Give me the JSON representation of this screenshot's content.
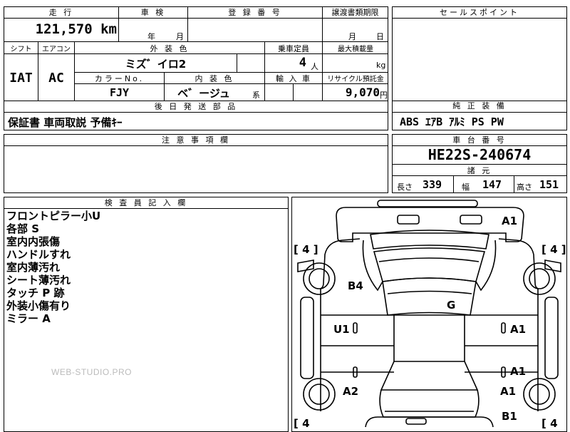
{
  "top": {
    "mileage_label": "走 行",
    "mileage_value": "121,570",
    "mileage_unit": "km",
    "inspection_label": "車 検",
    "inspection_year": "年",
    "inspection_month": "月",
    "registration_label": "登 録 番 号",
    "transfer_label": "譲渡書類期限",
    "transfer_month": "月",
    "transfer_day": "日",
    "sales_label": "セールスポイント"
  },
  "row2": {
    "shift_label": "シフト",
    "shift_value": "IAT",
    "ac_label": "エアコン",
    "ac_value": "AC",
    "exterior_label": "外 装 色",
    "exterior_value": "ミズ゛イロ2",
    "capacity_label": "乗車定員",
    "capacity_value": "4",
    "capacity_unit": "人",
    "load_label": "最大積載量",
    "load_unit": "kg",
    "colorno_label": "カラーNo.",
    "colorno_value": "FJY",
    "interior_label": "内 装 色",
    "interior_value": "ベ゛ージュ",
    "interior_suffix": "系",
    "import_label": "輸 入 車",
    "recycle_label": "リサイクル預託金",
    "recycle_value": "9,070",
    "recycle_unit": "円"
  },
  "parts": {
    "label": "後 日 発 送 部 品",
    "value": "保証書 車両取説 予備ｷｰ"
  },
  "equipment": {
    "label": "純 正 装 備",
    "value": "ABS ｴｱB ｱﾙﾐ PS PW"
  },
  "notes": {
    "label": "注 意 事 項 欄"
  },
  "chassis": {
    "label": "車 台 番 号",
    "value": "HE22S-240674"
  },
  "specs": {
    "label": "諸 元",
    "length_label": "長さ",
    "length_value": "339",
    "width_label": "幅",
    "width_value": "147",
    "height_label": "高さ",
    "height_value": "151"
  },
  "inspector": {
    "label": "検 査 員 記 入 欄",
    "remarks": [
      "フロントピラー小U",
      "各部 S",
      "室内内張傷",
      "ハンドルすれ",
      "室内薄汚れ",
      "シート薄汚れ",
      "タッチ P 跡",
      "外装小傷有り",
      "ミラー A"
    ]
  },
  "watermark": "WEB-STUDIO.PRO",
  "diagram": {
    "tire_tl": "[ 4 ]",
    "tire_tr": "[ 4 ]",
    "tire_bl": "[ 4",
    "tire_br": "[ 4",
    "a1_top": "A1",
    "b4": "B4",
    "g": "G",
    "u1": "U1",
    "a1_right_mid": "A1",
    "a1_right_low": "A1",
    "a2": "A2",
    "a1_rear": "A1",
    "b1": "B1"
  }
}
